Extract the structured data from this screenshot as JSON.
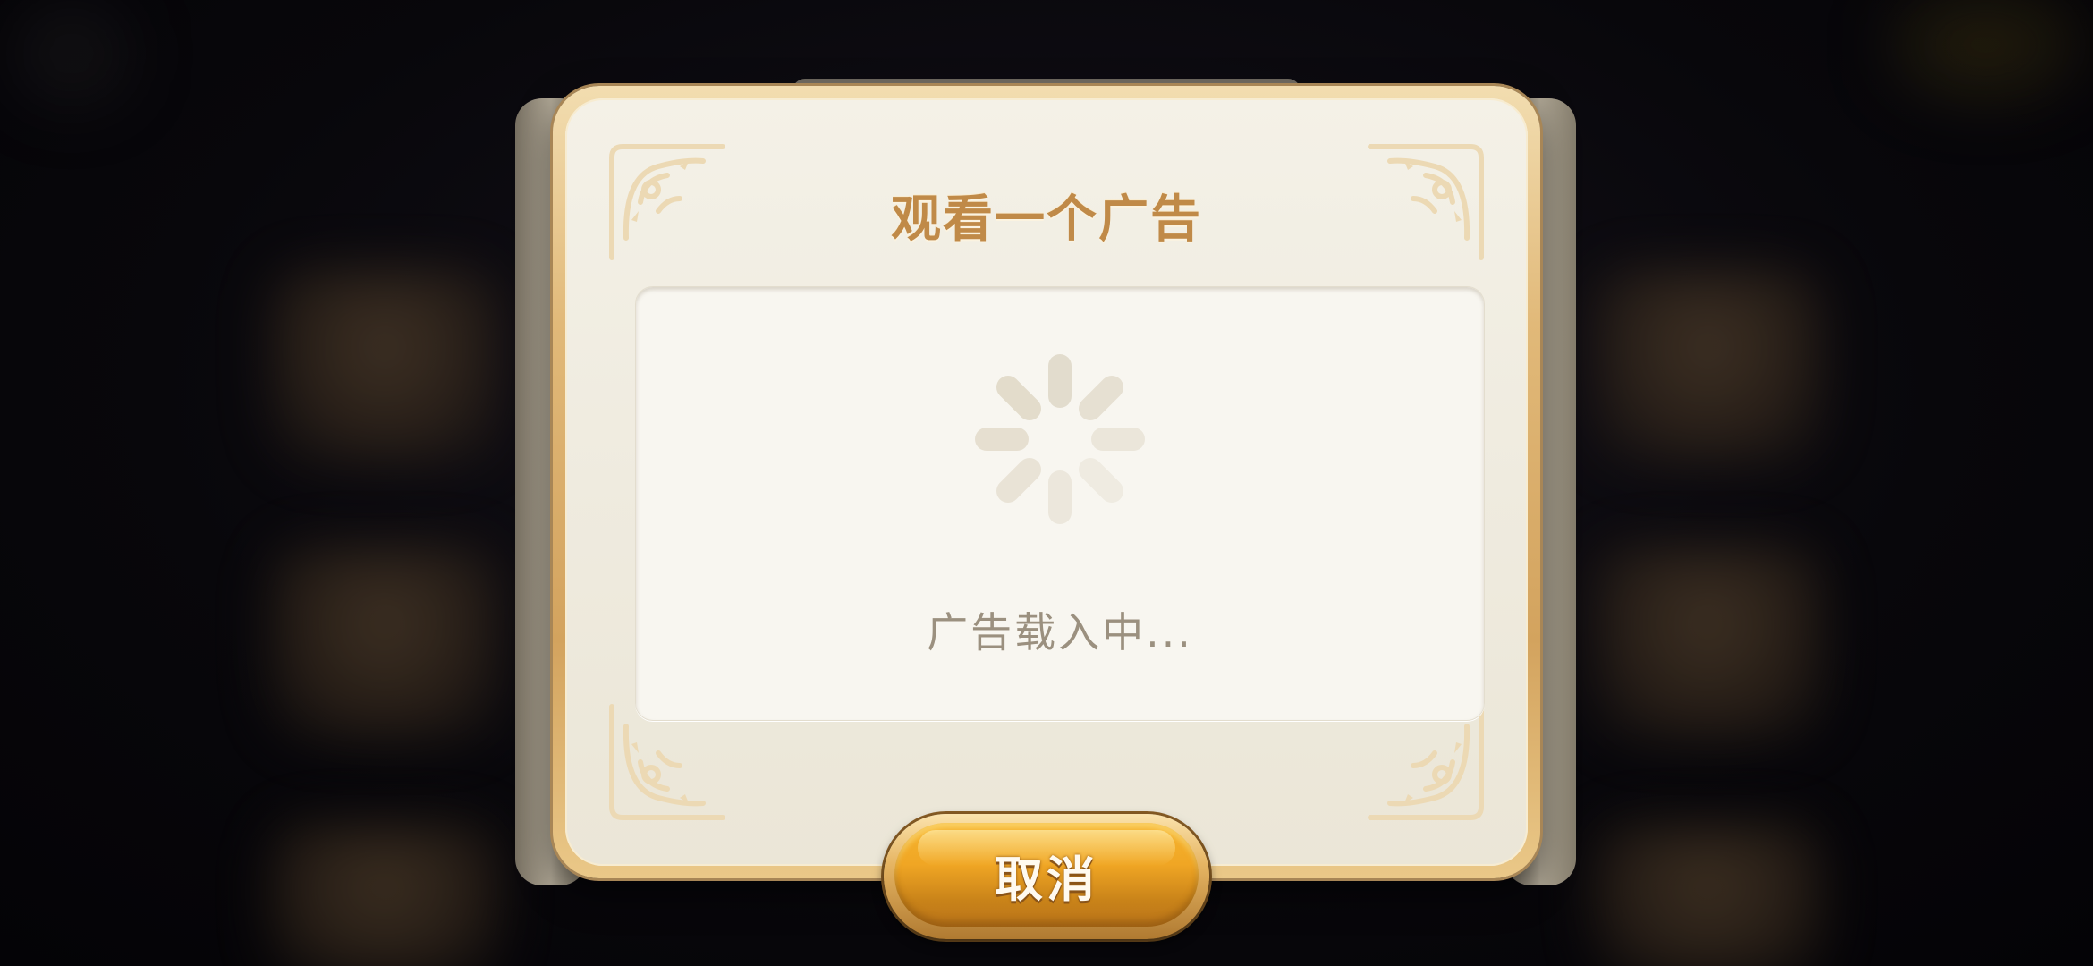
{
  "dialog": {
    "title": "观看一个广告",
    "loading_text": "广告载入中...",
    "cancel_label": "取消"
  },
  "icons": {
    "spinner": "loading-spinner-icon",
    "corner_ornament": "filigree-ornament-icon"
  },
  "colors": {
    "title": "#c08a48",
    "loading_text": "#9b907f",
    "button": "#f0a624",
    "frame": "#e1b979",
    "panel": "#f8f6f0"
  }
}
